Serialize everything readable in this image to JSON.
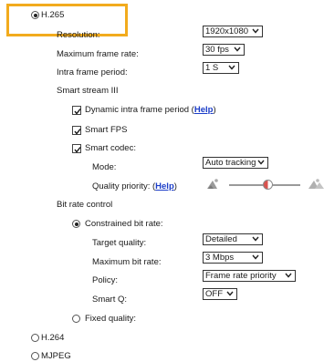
{
  "codecs": {
    "h265": {
      "label": "H.265",
      "selected": true
    },
    "h264": {
      "label": "H.264",
      "selected": false
    },
    "mjpeg": {
      "label": "MJPEG",
      "selected": false
    }
  },
  "resolution": {
    "label": "Resolution:",
    "value": "1920x1080"
  },
  "frame_rate": {
    "label": "Maximum frame rate:",
    "value": "30 fps"
  },
  "intra_period": {
    "label": "Intra frame period:",
    "value": "1 S"
  },
  "smart_stream": {
    "title": "Smart stream III",
    "dynamic_intra": {
      "label": "Dynamic intra frame period (",
      "help": "Help",
      "close": ")",
      "checked": true
    },
    "smart_fps": {
      "label": "Smart FPS",
      "checked": true
    },
    "smart_codec": {
      "label": "Smart codec:",
      "checked": true
    },
    "mode": {
      "label": "Mode:",
      "value": "Auto tracking"
    },
    "quality_priority": {
      "label": "Quality priority: (",
      "help": "Help",
      "close": ")",
      "level": 0.55
    }
  },
  "bit_rate": {
    "title": "Bit rate control",
    "constrained": {
      "label": "Constrained bit rate:",
      "selected": true
    },
    "target_quality": {
      "label": "Target quality:",
      "value": "Detailed"
    },
    "max_bit_rate": {
      "label": "Maximum bit rate:",
      "value": "3 Mbps"
    },
    "policy": {
      "label": "Policy:",
      "value": "Frame rate priority"
    },
    "smart_q": {
      "label": "Smart Q:",
      "value": "OFF"
    },
    "fixed": {
      "label": "Fixed quality:",
      "selected": false
    }
  }
}
